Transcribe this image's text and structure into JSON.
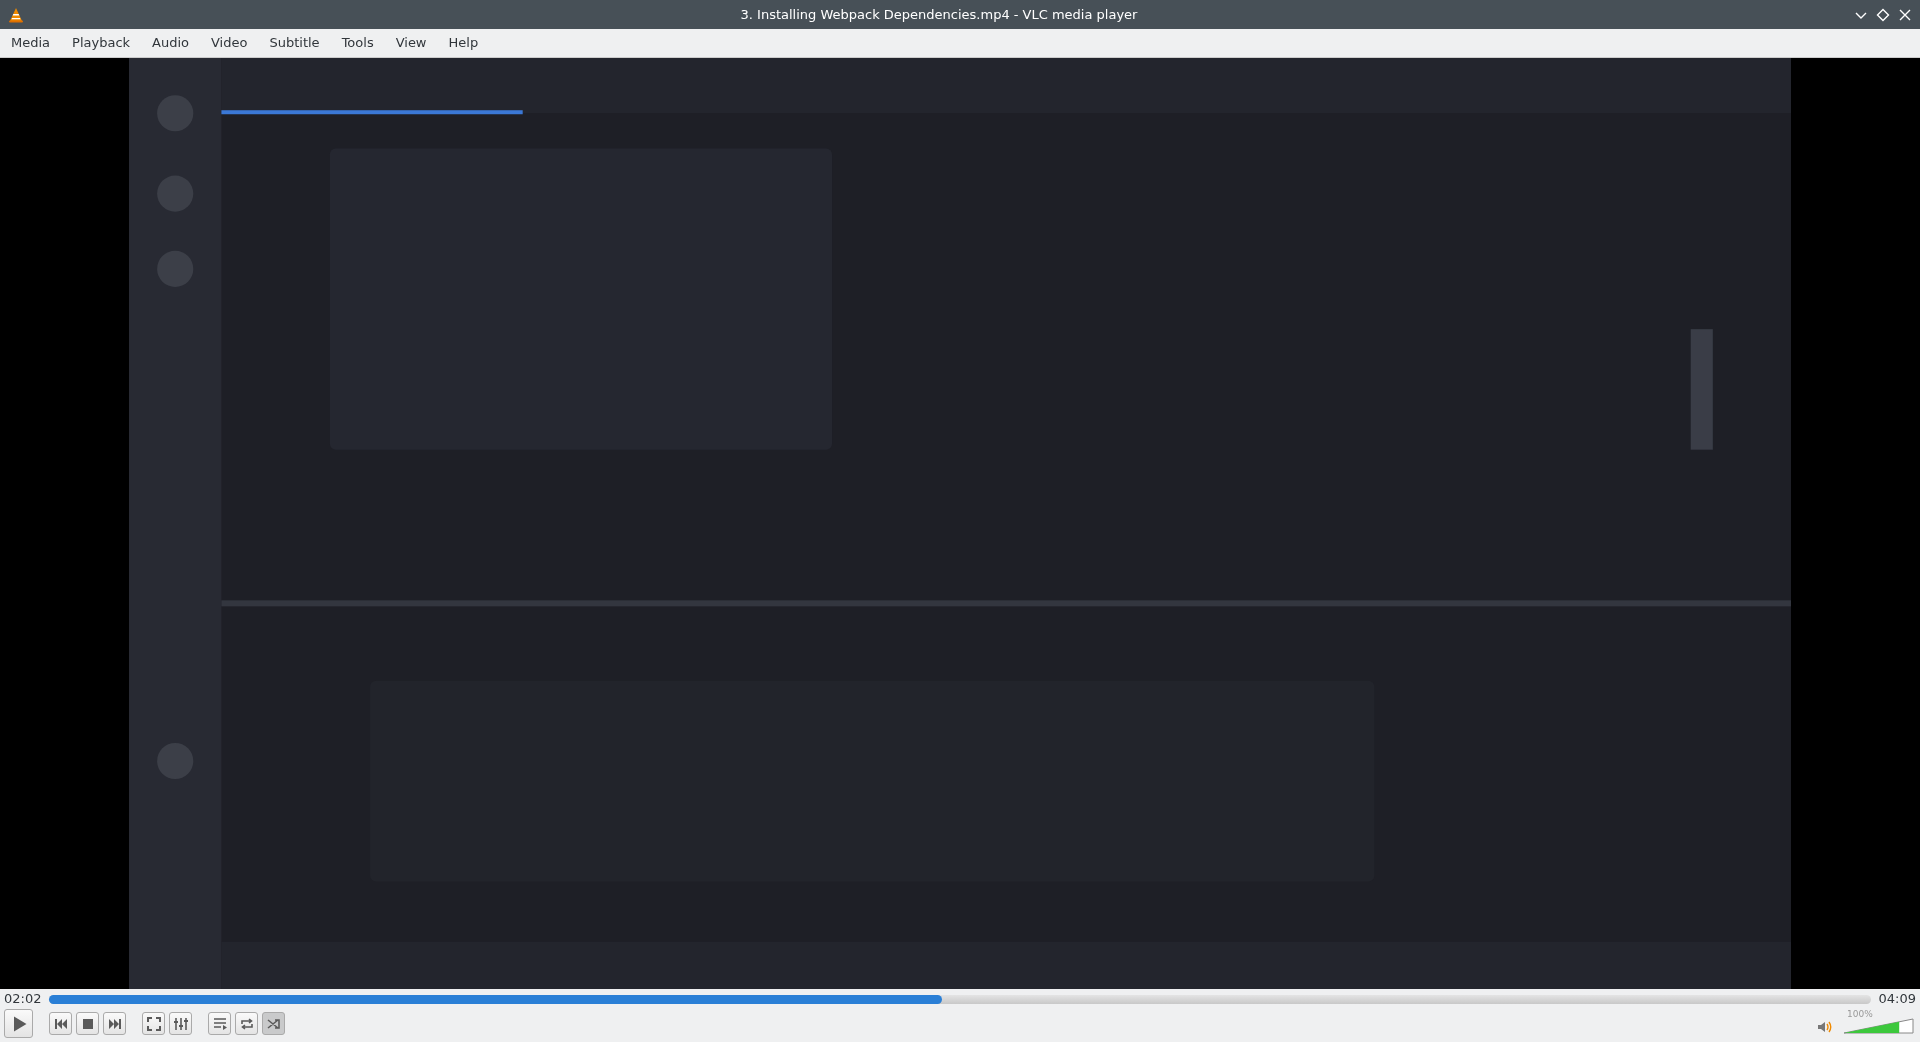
{
  "window": {
    "title": "3. Installing Webpack Dependencies.mp4 - VLC media player"
  },
  "menu": [
    "Media",
    "Playback",
    "Audio",
    "Video",
    "Subtitle",
    "Tools",
    "View",
    "Help"
  ],
  "video": {
    "kind": "picture"
  },
  "seek": {
    "elapsed": "02:02",
    "total": "04:09",
    "level": 0.49
  },
  "control_groups": [
    [
      {
        "kind": "play"
      }
    ],
    [
      {
        "kind": "previous"
      },
      {
        "kind": "stop"
      },
      {
        "kind": "next"
      }
    ],
    [
      {
        "kind": "fullscreen"
      },
      {
        "kind": "extended"
      }
    ],
    [
      {
        "kind": "playlist"
      },
      {
        "kind": "loop",
        "on": false
      },
      {
        "kind": "shuffle",
        "on": true
      }
    ]
  ],
  "volume": {
    "reading": "100%",
    "level": 0.8
  }
}
